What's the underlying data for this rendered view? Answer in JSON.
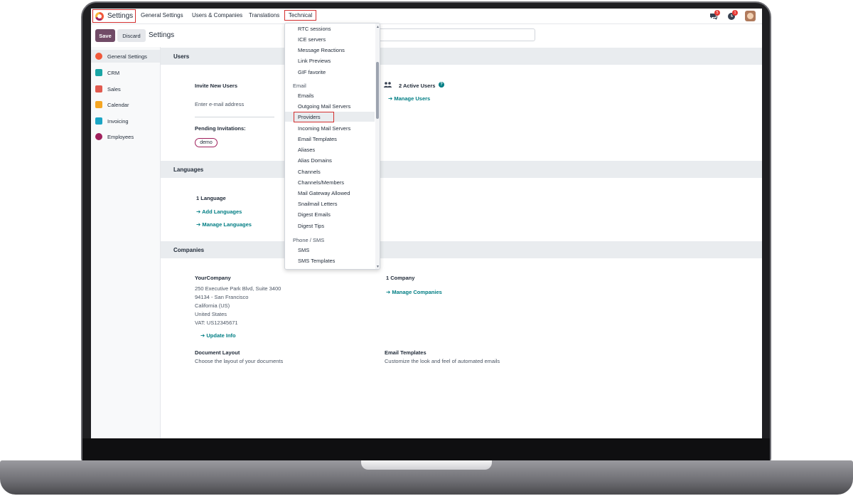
{
  "app": {
    "title": "Settings"
  },
  "nav": {
    "items": [
      "General Settings",
      "Users & Companies",
      "Translations",
      "Technical"
    ]
  },
  "systray": {
    "messages_badge": "5",
    "activity_badge": "1"
  },
  "control": {
    "save_label": "Save",
    "discard_label": "Discard",
    "breadcrumb": "Settings"
  },
  "sidebar": {
    "items": [
      {
        "label": "General Settings",
        "color": "#f1583a"
      },
      {
        "label": "CRM",
        "color": "#1aa5a5"
      },
      {
        "label": "Sales",
        "color": "#e15a4f"
      },
      {
        "label": "Calendar",
        "color": "#f5a623"
      },
      {
        "label": "Invoicing",
        "color": "#1aa5c5"
      },
      {
        "label": "Employees",
        "color": "#a0205c"
      }
    ]
  },
  "sections": {
    "users": {
      "title": "Users",
      "invite_label": "Invite New Users",
      "invite_placeholder": "Enter e-mail address",
      "pending_label": "Pending Invitations:",
      "pending_chip": "demo",
      "active_users": "2 Active Users",
      "manage_users": "Manage Users"
    },
    "languages": {
      "title": "Languages",
      "count": "1 Language",
      "add_languages": "Add Languages",
      "manage_languages": "Manage Languages"
    },
    "companies": {
      "title": "Companies",
      "company_name": "YourCompany",
      "address_line1": "250 Executive Park Blvd, Suite 3400",
      "address_line2": "94134 - San Francisco",
      "address_line3": "California (US)",
      "address_line4": "United States",
      "vat": "VAT:  US12345671",
      "update_info": "Update Info",
      "count": "1 Company",
      "manage_companies": "Manage Companies",
      "doc_layout_title": "Document Layout",
      "doc_layout_desc": "Choose the layout of your documents",
      "email_templates_title": "Email Templates",
      "email_templates_desc": "Customize the look and feel of automated emails"
    }
  },
  "dropdown": {
    "items": [
      {
        "type": "item",
        "label": "RTC sessions"
      },
      {
        "type": "item",
        "label": "ICE servers"
      },
      {
        "type": "item",
        "label": "Message Reactions"
      },
      {
        "type": "item",
        "label": "Link Previews"
      },
      {
        "type": "item",
        "label": "GIF favorite"
      },
      {
        "type": "header",
        "label": "Email"
      },
      {
        "type": "item",
        "label": "Emails"
      },
      {
        "type": "item",
        "label": "Outgoing Mail Servers"
      },
      {
        "type": "item",
        "label": "Providers",
        "selected": true
      },
      {
        "type": "item",
        "label": "Incoming Mail Servers"
      },
      {
        "type": "item",
        "label": "Email Templates"
      },
      {
        "type": "item",
        "label": "Aliases"
      },
      {
        "type": "item",
        "label": "Alias Domains"
      },
      {
        "type": "item",
        "label": "Channels"
      },
      {
        "type": "item",
        "label": "Channels/Members"
      },
      {
        "type": "item",
        "label": "Mail Gateway Allowed"
      },
      {
        "type": "item",
        "label": "Snailmail Letters"
      },
      {
        "type": "item",
        "label": "Digest Emails"
      },
      {
        "type": "item",
        "label": "Digest Tips"
      },
      {
        "type": "header",
        "label": "Phone / SMS"
      },
      {
        "type": "item",
        "label": "SMS"
      },
      {
        "type": "item",
        "label": "SMS Templates"
      }
    ]
  },
  "colors": {
    "primary": "#714b67",
    "link": "#017e84",
    "highlight_box": "#d32f2f"
  }
}
